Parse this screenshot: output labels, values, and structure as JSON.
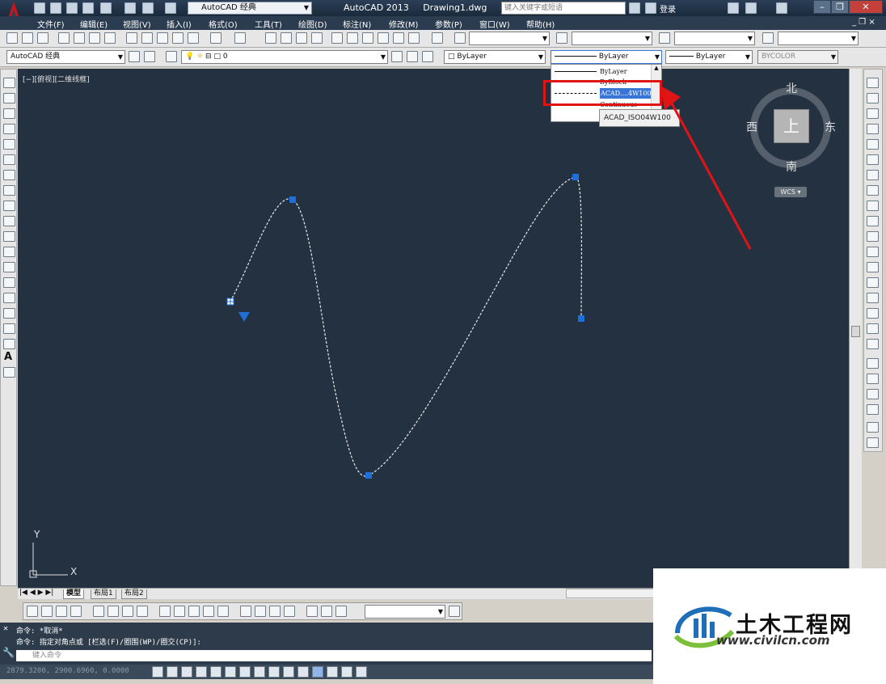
{
  "title_bar": {
    "workspace": "AutoCAD 经典",
    "app_name": "AutoCAD 2013",
    "document": "Drawing1.dwg",
    "search_placeholder": "键入关键字或短语",
    "login": "登录"
  },
  "menu": [
    "文件(F)",
    "编辑(E)",
    "视图(V)",
    "插入(I)",
    "格式(O)",
    "工具(T)",
    "绘图(D)",
    "标注(N)",
    "修改(M)",
    "参数(P)",
    "窗口(W)",
    "帮助(H)"
  ],
  "toolbar2": {
    "workspace_combo": "AutoCAD 经典",
    "layer_combo": "0",
    "color_combo": "ByLayer",
    "linetype_combo": "ByLayer",
    "lineweight_combo": "ByLayer",
    "plotstyle_combo": "BYCOLOR"
  },
  "viewport_label": "[−][俯视][二维线框]",
  "viewcube": {
    "face": "上",
    "north": "北",
    "south": "南",
    "east": "东",
    "west": "西",
    "ucs": "WCS"
  },
  "linetype_dropdown": {
    "items": [
      {
        "name": "ByLayer",
        "style": "solid",
        "selected": false
      },
      {
        "name": "ByBlock",
        "style": "solid",
        "selected": false
      },
      {
        "name": "ACAD....4W100",
        "style": "dash",
        "selected": true
      },
      {
        "name": "Continuous",
        "style": "solid",
        "selected": false
      }
    ],
    "tooltip": "ACAD_ISO04W100",
    "highlight_color": "#e01414"
  },
  "ucs_axes": {
    "x": "X",
    "y": "Y"
  },
  "layout_tabs": [
    "模型",
    "布局1",
    "布局2"
  ],
  "command_history": [
    "命令: *取消*",
    "命令: 指定对角点或 [栏选(F)/圈围(WP)/圈交(CP)]:"
  ],
  "command_placeholder": "键入命令",
  "coordinates": "2879.3200, 2900.6960, 0.0000",
  "watermark": {
    "brand": "土木工程网",
    "url": "www.civilcn.com"
  },
  "colors": {
    "canvas": "#243140",
    "grip": "#1e6fd9",
    "annotation": "#e01414"
  }
}
